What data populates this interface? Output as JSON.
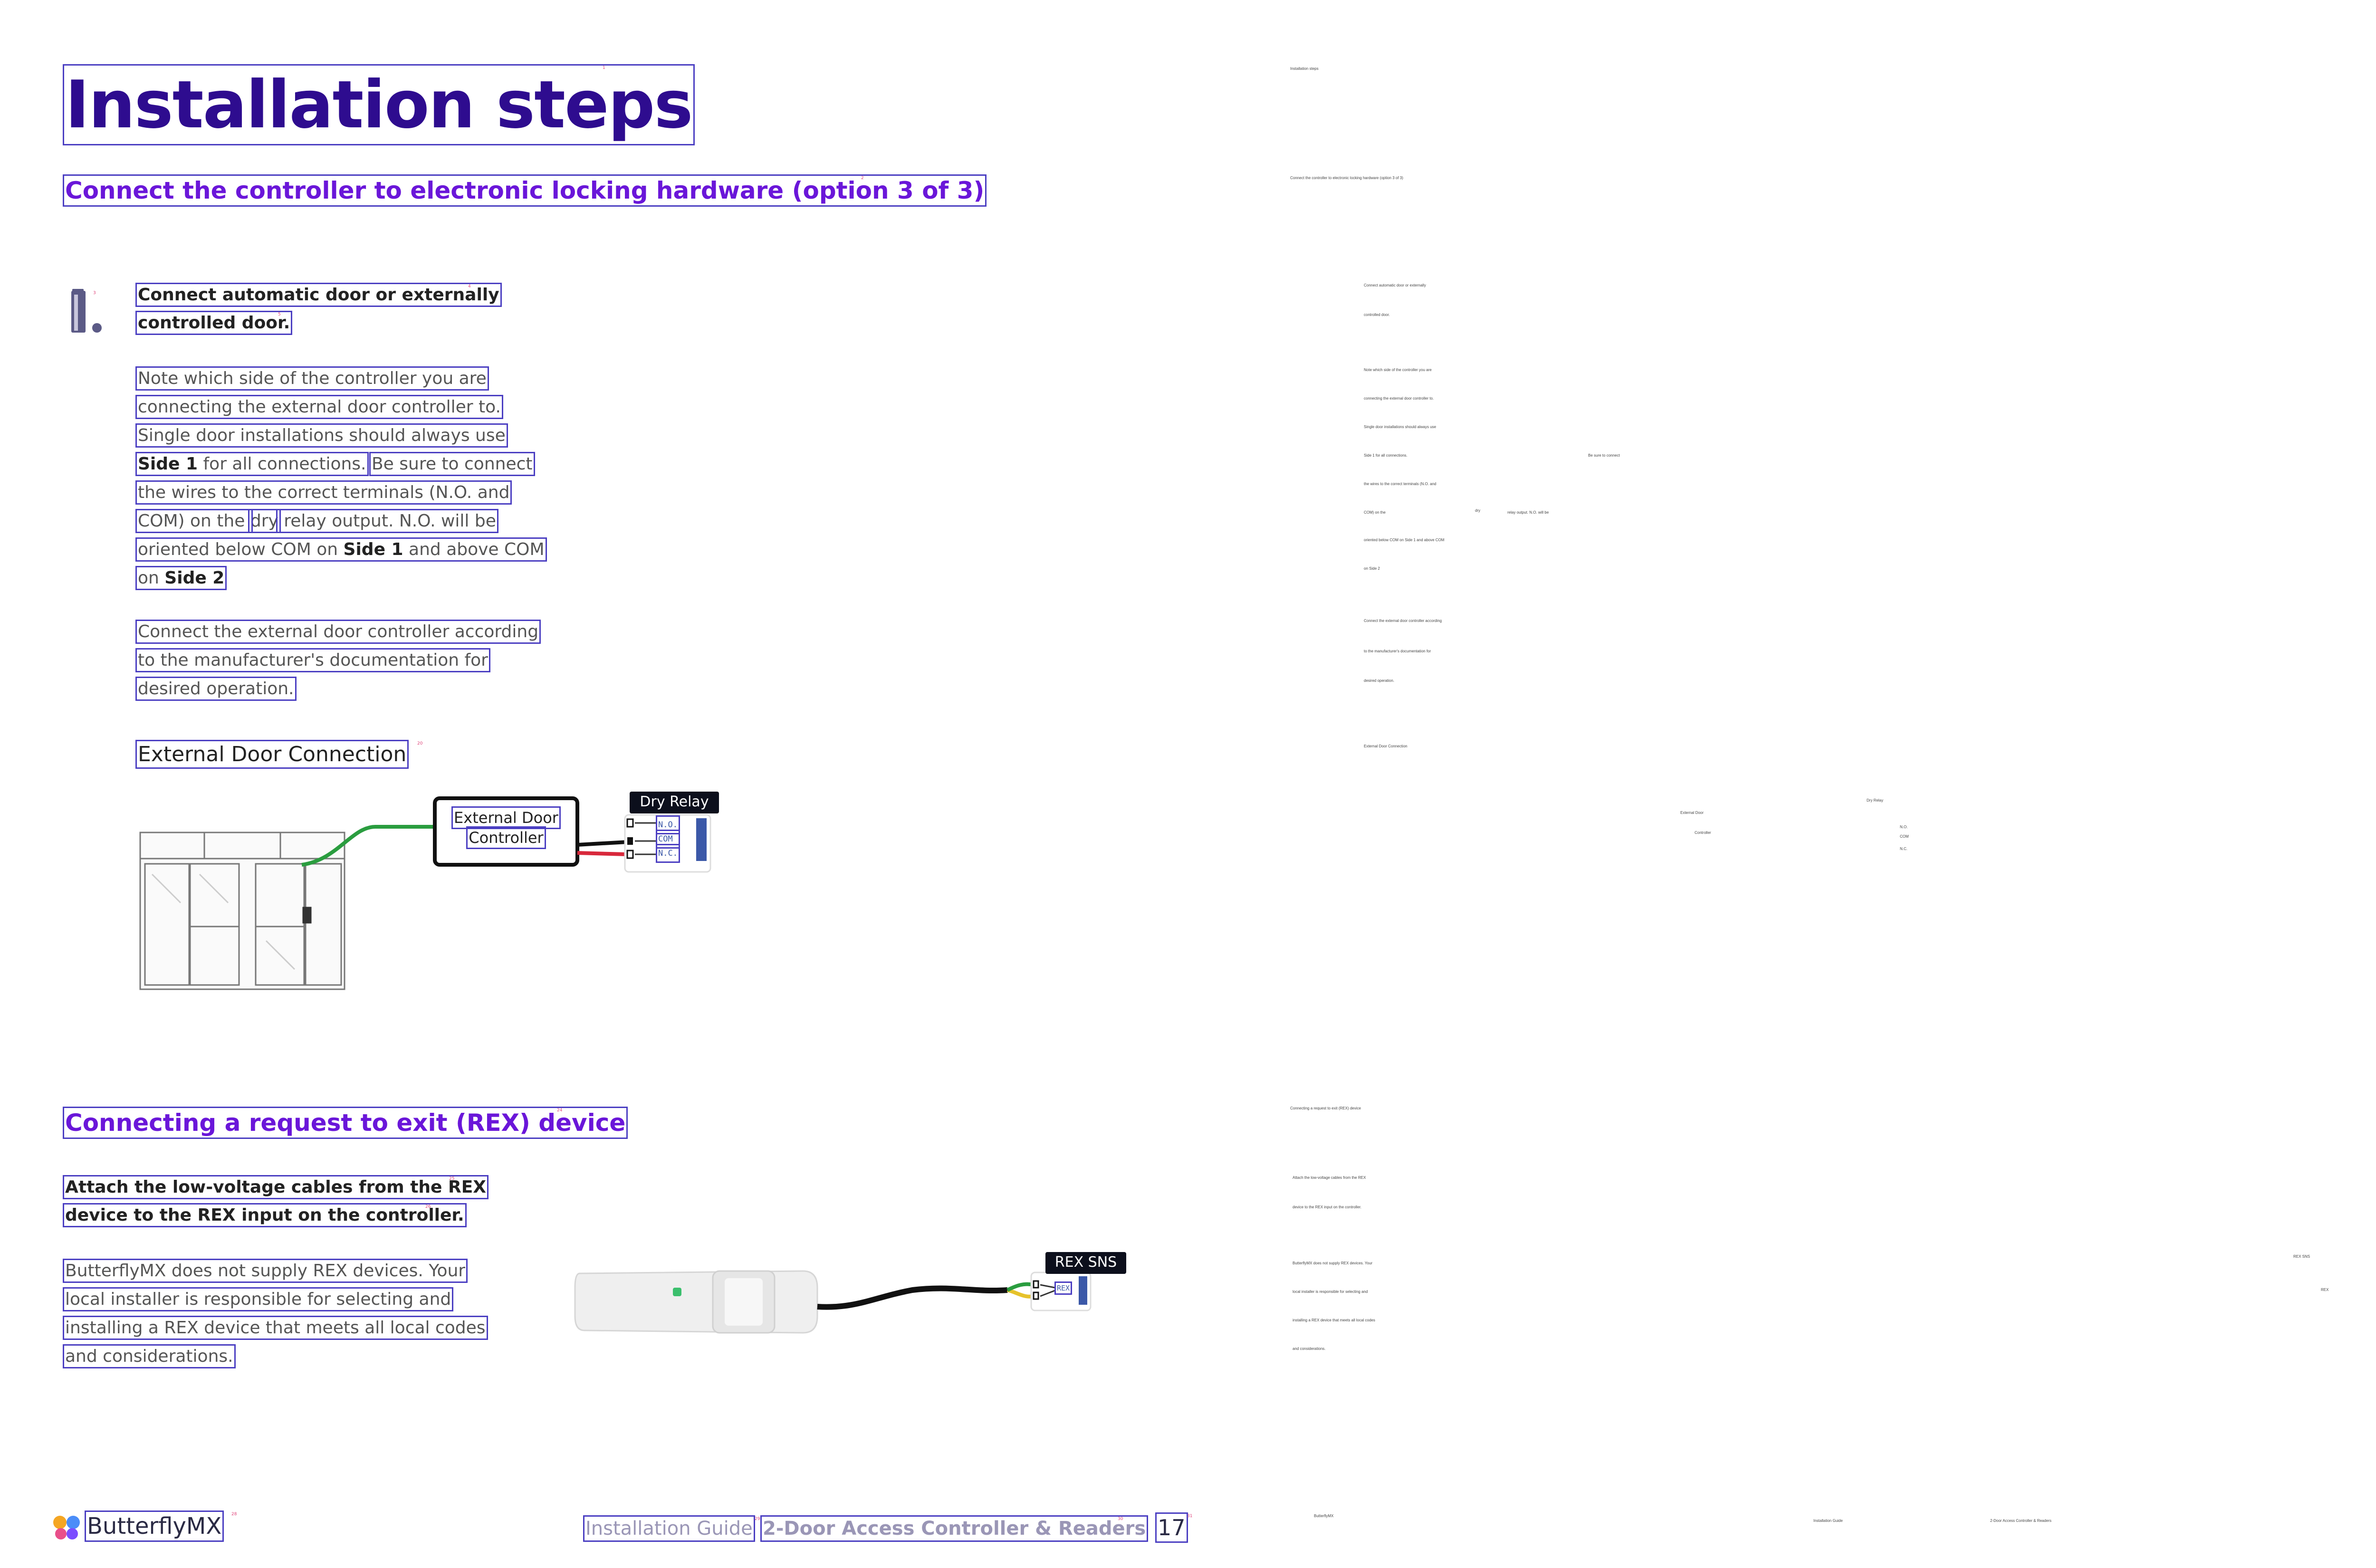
{
  "page": {
    "title": "Installation steps",
    "section1_heading": "Connect the controller to electronic locking hardware (option 3 of 3)",
    "step1": {
      "title_line1": "Connect automatic door or externally",
      "title_line2": "controlled door.",
      "para1": {
        "l1": "Note which side of the controller you are",
        "l2": "connecting the external door controller to.",
        "l3": "Single door installations should always use",
        "l4_bold": "Side 1",
        "l4_rest": " for all connections.",
        "l4_b": "Be sure to connect",
        "l5": "the wires to the correct terminals (N.O. and",
        "l6_a": "COM) on the ",
        "l6_b": "dry",
        "l6_c": " relay output. N.O. will be",
        "l7_a": "oriented below COM on ",
        "l7_bold": "Side 1",
        "l7_c": " and above COM",
        "l8_a": "on ",
        "l8_bold": "Side 2"
      },
      "para2": {
        "l1": "Connect the external door controller according",
        "l2": "to the manufacturer's documentation for",
        "l3": "desired operation."
      },
      "subheading": "External Door Connection"
    },
    "diagram1": {
      "controller_line1": "External Door",
      "controller_line2": "Controller",
      "relay_label": "Dry Relay",
      "terminal_no": "N.O.",
      "terminal_com": "COM",
      "terminal_nc": "N.C."
    },
    "section2_heading": "Connecting a request to exit (REX) device",
    "step2": {
      "title_line1": "Attach the low-voltage cables from the REX",
      "title_line2": "device to the REX input on the controller.",
      "para": {
        "l1": "ButterflyMX does not supply REX devices. Your",
        "l2": "local installer is responsible for selecting and",
        "l3": "installing a REX device that meets all local codes",
        "l4": "and considerations."
      }
    },
    "diagram2": {
      "rex_label": "REX SNS",
      "terminal_rex": "REX"
    },
    "footer": {
      "brand": "ButterflyMX",
      "guide": "Installation Guide",
      "product": "2-Door Access Controller & Readers",
      "page_number": "17"
    },
    "colors": {
      "title": "#2e0c8f",
      "heading": "#6a16d9",
      "box_outline": "#4b3fc2",
      "wire_green": "#2a9d3f",
      "wire_red": "#d8283b",
      "wire_yellow": "#e6c22b"
    }
  }
}
